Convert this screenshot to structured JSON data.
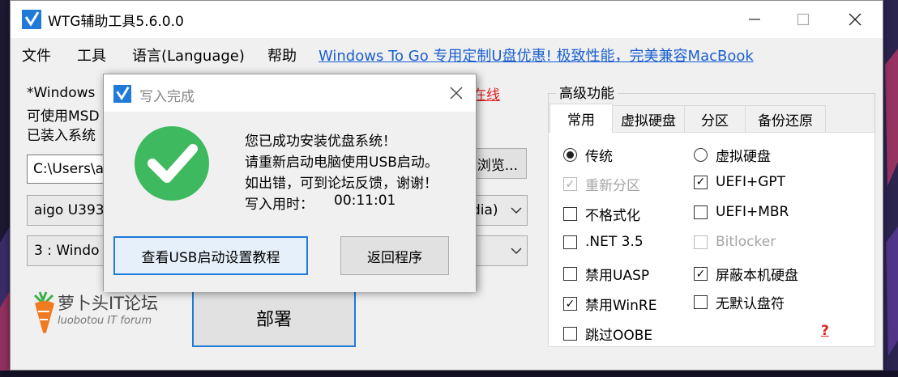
{
  "window": {
    "title": "WTG辅助工具5.6.0.0",
    "minimize_icon": "minimize-icon",
    "maximize_icon": "maximize-icon",
    "close_icon": "close-icon"
  },
  "menu": {
    "items": [
      "文件",
      "工具",
      "语言(Language)",
      "帮助"
    ],
    "promo_link": "Windows To Go 专用定制U盘优惠! 极致性能，完美兼容MacBook"
  },
  "main": {
    "info_lines": [
      "*Windows",
      "可使用MSD",
      "已装入系统"
    ],
    "red_link": "在线",
    "path_value": "C:\\Users\\a",
    "browse_label": "浏览...",
    "disk_value": "aigo U393",
    "disk_suffix": "dia)",
    "version_value": "3 : Windo",
    "deploy_label": "部署"
  },
  "forum": {
    "name": "萝卜头IT论坛",
    "sub": "luobotou IT forum"
  },
  "advanced": {
    "title": "高级功能",
    "tabs": [
      "常用",
      "虚拟硬盘",
      "分区",
      "备份还原"
    ],
    "active_tab": "常用",
    "options": [
      {
        "label": "传统",
        "type": "radio",
        "checked": true,
        "disabled": false
      },
      {
        "label": "虚拟硬盘",
        "type": "radio",
        "checked": false,
        "disabled": false
      },
      {
        "label": "重新分区",
        "type": "checkbox",
        "checked": true,
        "disabled": true
      },
      {
        "label": "UEFI+GPT",
        "type": "checkbox",
        "checked": true,
        "disabled": false
      },
      {
        "label": "不格式化",
        "type": "checkbox",
        "checked": false,
        "disabled": false
      },
      {
        "label": "UEFI+MBR",
        "type": "checkbox",
        "checked": false,
        "disabled": false
      },
      {
        "label": ".NET 3.5",
        "type": "checkbox",
        "checked": false,
        "disabled": false
      },
      {
        "label": "Bitlocker",
        "type": "checkbox",
        "checked": false,
        "disabled": true
      },
      {
        "label": "禁用UASP",
        "type": "checkbox",
        "checked": false,
        "disabled": false
      },
      {
        "label": "屏蔽本机硬盘",
        "type": "checkbox",
        "checked": true,
        "disabled": false
      },
      {
        "label": "禁用WinRE",
        "type": "checkbox",
        "checked": true,
        "disabled": false
      },
      {
        "label": "无默认盘符",
        "type": "checkbox",
        "checked": false,
        "disabled": false
      },
      {
        "label": "跳过OOBE",
        "type": "checkbox",
        "checked": false,
        "disabled": false
      }
    ],
    "help_label": "?"
  },
  "dialog": {
    "title": "写入完成",
    "messages": [
      "您已成功安装优盘系统！",
      "请重新启动电脑使用USB启动。",
      "如出错，可到论坛反馈，谢谢！"
    ],
    "time_label": "写入用时：",
    "time_value": "00:11:01",
    "tutorial_button": "查看USB启动设置教程",
    "back_button": "返回程序",
    "status_icon": "success-check-icon"
  },
  "colors": {
    "accent": "#1f7ad8",
    "link": "#1a5fd0",
    "warning": "#e02020",
    "success": "#3fb95f"
  }
}
